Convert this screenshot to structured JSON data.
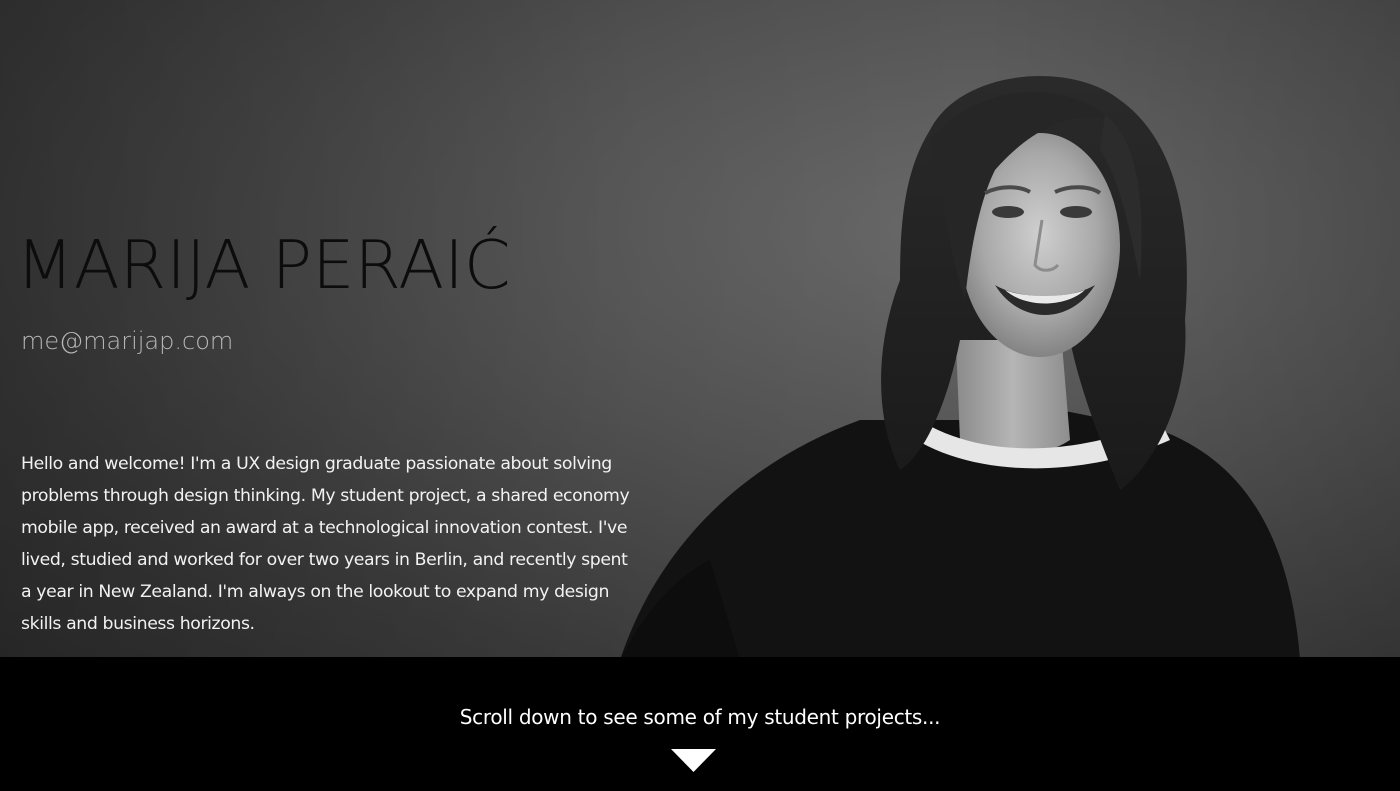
{
  "hero": {
    "name": "MARIJA PERAIĆ",
    "email": "me@marijap.com",
    "bio": "Hello and welcome! I'm a UX design graduate passionate about solving problems through design thinking. My student project, a shared economy mobile app, received an award at a technological innovation contest. I've lived, studied and worked for over two years in Berlin, and recently spent a year in New Zealand. I'm always on the lookout to expand my design skills and business horizons."
  },
  "footer": {
    "scroll_text": "Scroll down to see some of my student projects..."
  },
  "icons": {
    "scroll": "chevron-down-icon"
  },
  "colors": {
    "background_dark": "#000000",
    "name_text": "#0c0c0c",
    "email_text": "#b7b7b7",
    "body_text": "#f2f2f2"
  }
}
